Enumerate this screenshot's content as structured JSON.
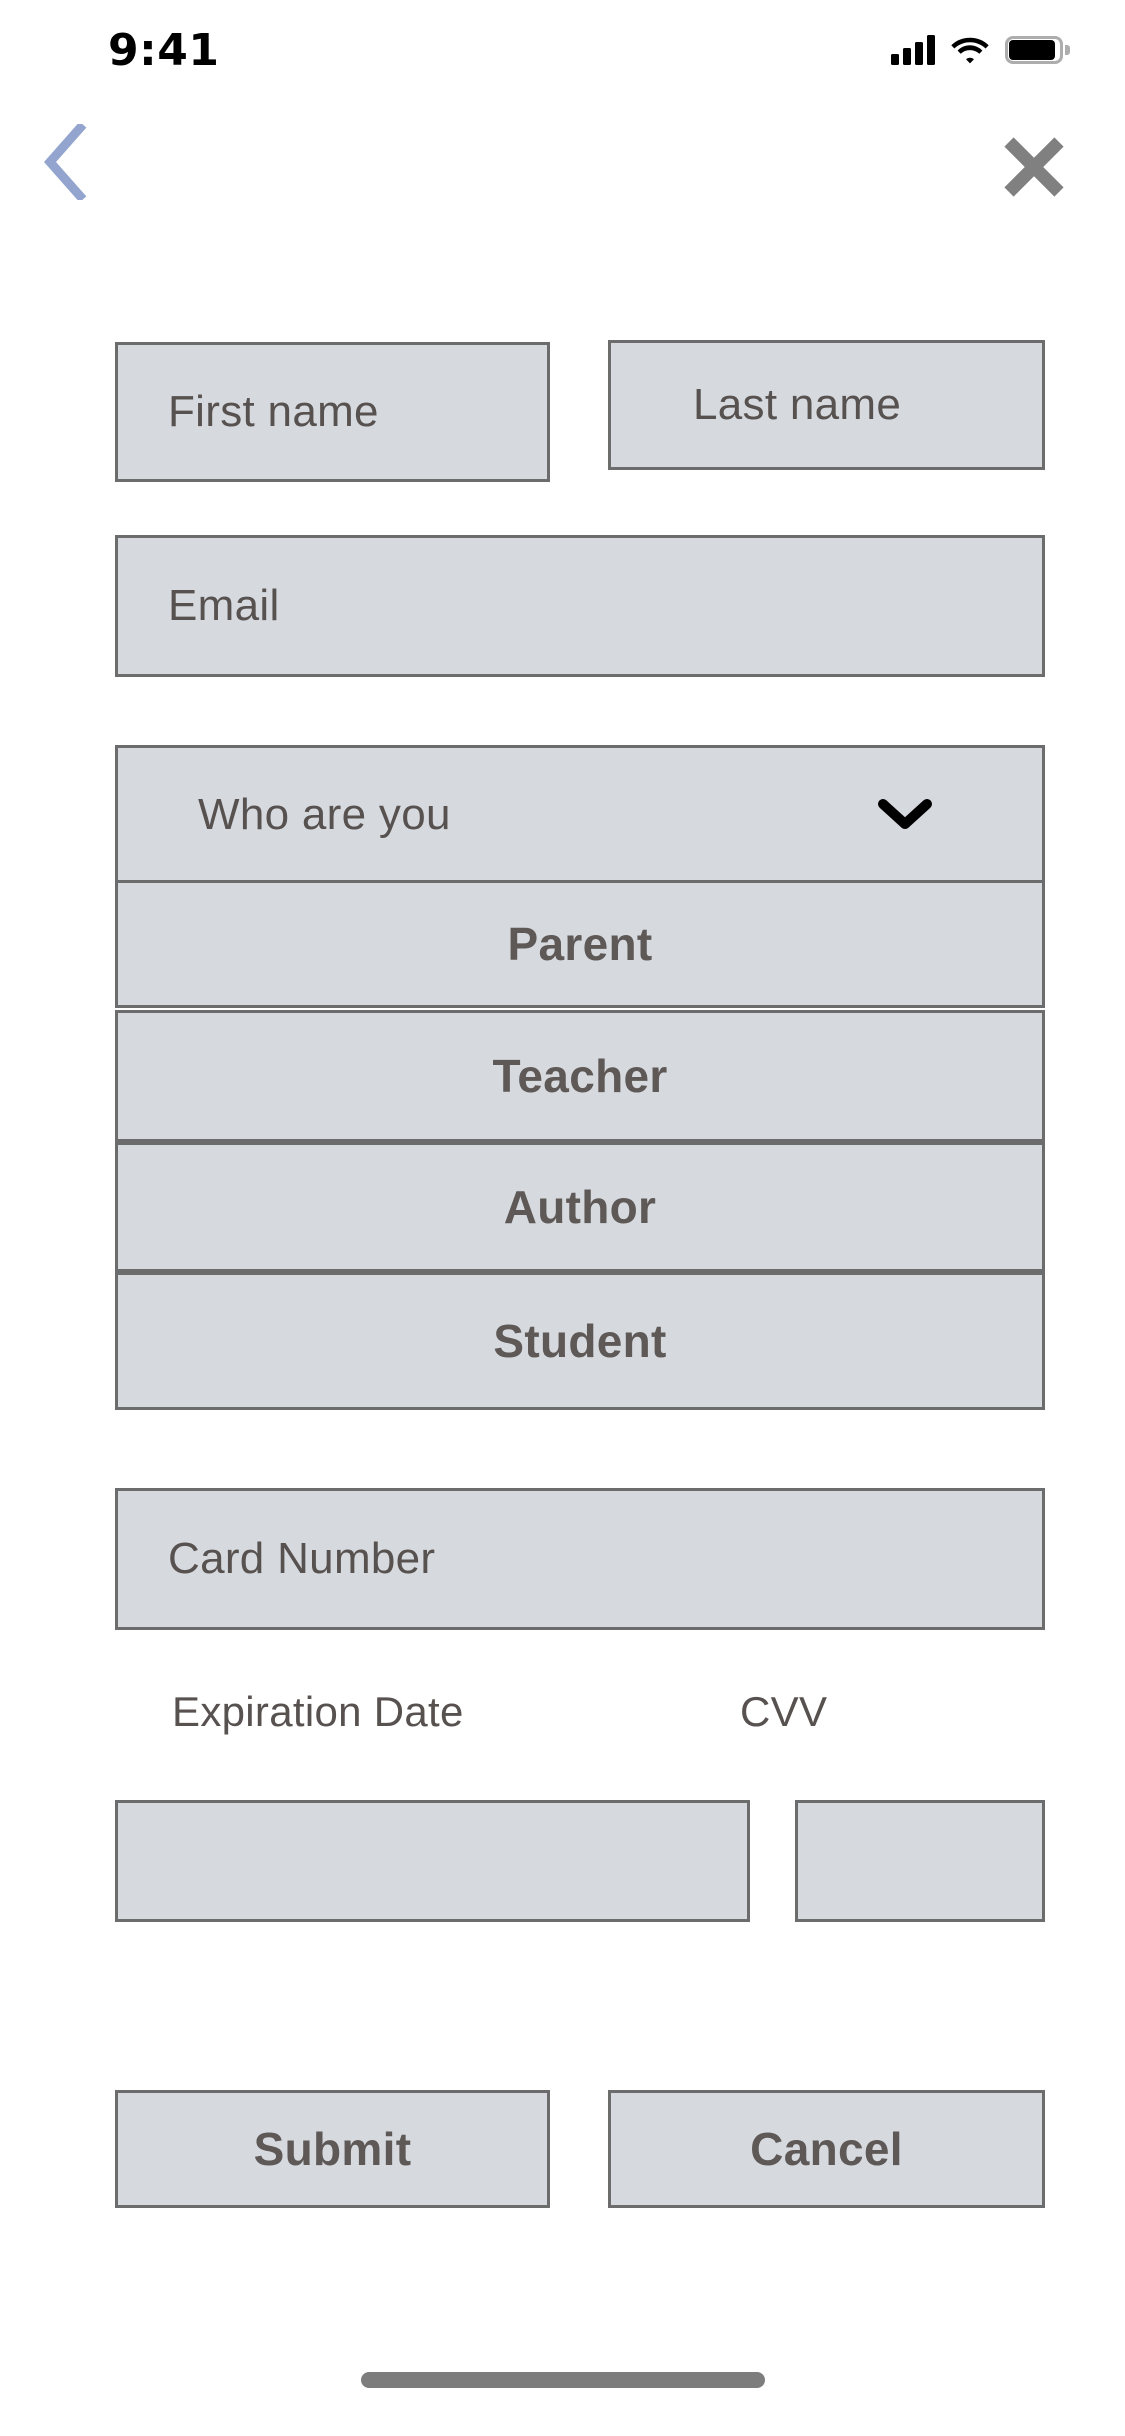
{
  "status_bar": {
    "time": "9:41",
    "signal_icon": "cellular-signal-icon",
    "wifi_icon": "wifi-icon",
    "battery_icon": "battery-full-icon"
  },
  "nav": {
    "back_icon": "chevron-left-icon",
    "close_icon": "close-x-icon",
    "back_color": "#93a4ce",
    "close_color": "#808080"
  },
  "form": {
    "first_name": {
      "placeholder": "First name",
      "value": ""
    },
    "last_name": {
      "placeholder": "Last name",
      "value": ""
    },
    "email": {
      "placeholder": "Email",
      "value": ""
    },
    "role_select": {
      "placeholder": "Who are  you",
      "value": "",
      "chevron_icon": "chevron-down-icon",
      "options": [
        "Parent",
        "Teacher",
        "Author",
        "Student"
      ]
    },
    "card_number": {
      "placeholder": "Card Number",
      "value": ""
    },
    "expiration_label": "Expiration Date",
    "expiration": {
      "placeholder": "",
      "value": ""
    },
    "cvv_label": "CVV",
    "cvv": {
      "placeholder": "",
      "value": ""
    },
    "submit_label": "Submit",
    "cancel_label": "Cancel"
  },
  "colors": {
    "field_fill": "#d6dadf",
    "field_border": "#6c6c6c",
    "text": "#57514f",
    "bold_text": "#5e5856",
    "background": "#ffffff"
  }
}
